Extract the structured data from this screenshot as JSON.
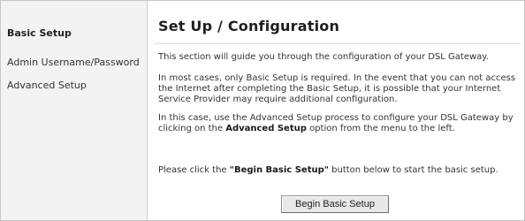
{
  "sidebar": {
    "items": [
      {
        "label": "Basic Setup",
        "active": true
      },
      {
        "label": "Admin Username/Password",
        "active": false
      },
      {
        "label": "Advanced Setup",
        "active": false
      }
    ]
  },
  "main": {
    "title": "Set Up / Configuration",
    "para1": "This section will guide you through the configuration of your DSL Gateway.",
    "para2": "In most cases, only Basic Setup is required. In the event that you can not access the Internet after completing the Basic Setup, it is possible that your Internet Service Provider may require additional configuration.",
    "para3_before": "In this case, use the Advanced Setup process to configure your DSL Gateway by clicking on the ",
    "para3_bold": "Advanced Setup",
    "para3_after": " option from the menu to the left.",
    "para4_before": "Please click the ",
    "para4_bold": "\"Begin Basic Setup\"",
    "para4_after": " button below to start the basic setup.",
    "button_label": "Begin Basic Setup"
  },
  "colors": {
    "sidebar_bg": "#f3f3f3",
    "text": "#333333",
    "border": "#c8c8c8"
  }
}
